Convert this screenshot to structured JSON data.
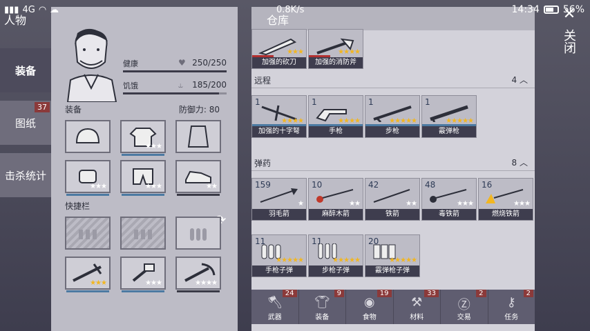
{
  "status_bar": {
    "signal": "4G",
    "speed": "0.8K/s",
    "time": "14:34",
    "battery": "56%"
  },
  "left_tabs": [
    {
      "label": "装备",
      "badge": ""
    },
    {
      "label": "图纸",
      "badge": "37"
    },
    {
      "label": "击杀统计",
      "badge": ""
    }
  ],
  "character": {
    "title": "人物",
    "health": {
      "label": "健康",
      "value": "250/250",
      "fraction": 1.0
    },
    "hunger": {
      "label": "饥饿",
      "value": "185/200",
      "fraction": 0.925
    },
    "equip_label": "装备",
    "defense_label": "防御力:",
    "defense_value": "80",
    "quickbar_label": "快捷栏",
    "equipment_slots": [
      {
        "icon": "helmet-icon",
        "stars": ""
      },
      {
        "icon": "jacket-icon",
        "stars": "★★★"
      },
      {
        "icon": "vest-icon",
        "stars": ""
      },
      {
        "icon": "gloves-icon",
        "stars": "★★★"
      },
      {
        "icon": "pants-icon",
        "stars": "★★★"
      },
      {
        "icon": "shoes-icon",
        "stars": "★★"
      }
    ],
    "quick_slots": [
      {
        "icon": "empty-slot-icon",
        "stars": ""
      },
      {
        "icon": "empty-slot-icon",
        "stars": ""
      },
      {
        "icon": "ammo-icon",
        "stars": ""
      },
      {
        "icon": "crossbow-icon",
        "stars": "★★★"
      },
      {
        "icon": "hammer-icon",
        "stars": "★★★"
      },
      {
        "icon": "pickaxe-icon",
        "stars": "★★★★"
      }
    ]
  },
  "warehouse": {
    "title": "仓库",
    "melee_items": [
      {
        "label": "加强的砍刀",
        "stars": "★★★"
      },
      {
        "label": "加强的消防斧",
        "stars": "★★★★"
      }
    ],
    "ranged": {
      "name": "远程",
      "count": "4",
      "items": [
        {
          "num": "1",
          "label": "加强的十字弩",
          "stars": "★★★★"
        },
        {
          "num": "1",
          "label": "手枪",
          "stars": "★★★★"
        },
        {
          "num": "1",
          "label": "步枪",
          "stars": "★★★★★"
        },
        {
          "num": "1",
          "label": "霰弹枪",
          "stars": "★★★★★"
        }
      ]
    },
    "ammo": {
      "name": "弹药",
      "count": "8",
      "items": [
        {
          "num": "159",
          "label": "羽毛箭",
          "stars": "★"
        },
        {
          "num": "10",
          "label": "麻醉木箭",
          "stars": "★★"
        },
        {
          "num": "42",
          "label": "铁箭",
          "stars": "★★"
        },
        {
          "num": "48",
          "label": "毒铁箭",
          "stars": "★★★"
        },
        {
          "num": "16",
          "label": "燃烧铁箭",
          "stars": "★★★"
        },
        {
          "num": "11",
          "label": "手枪子弹",
          "stars": "★★★★★"
        },
        {
          "num": "11",
          "label": "步枪子弹",
          "stars": "★★★★★"
        },
        {
          "num": "20",
          "label": "霰弹枪子弹",
          "stars": "★★★★★"
        }
      ]
    }
  },
  "bottom_tabs": [
    {
      "label": "武器",
      "count": "24",
      "icon": "axe-icon"
    },
    {
      "label": "装备",
      "count": "9",
      "icon": "shirt-icon"
    },
    {
      "label": "食物",
      "count": "19",
      "icon": "food-icon"
    },
    {
      "label": "材料",
      "count": "33",
      "icon": "material-icon"
    },
    {
      "label": "交易",
      "count": "2",
      "icon": "coin-icon"
    },
    {
      "label": "任务",
      "count": "2",
      "icon": "key-icon"
    }
  ],
  "close": {
    "label": "关闭"
  }
}
